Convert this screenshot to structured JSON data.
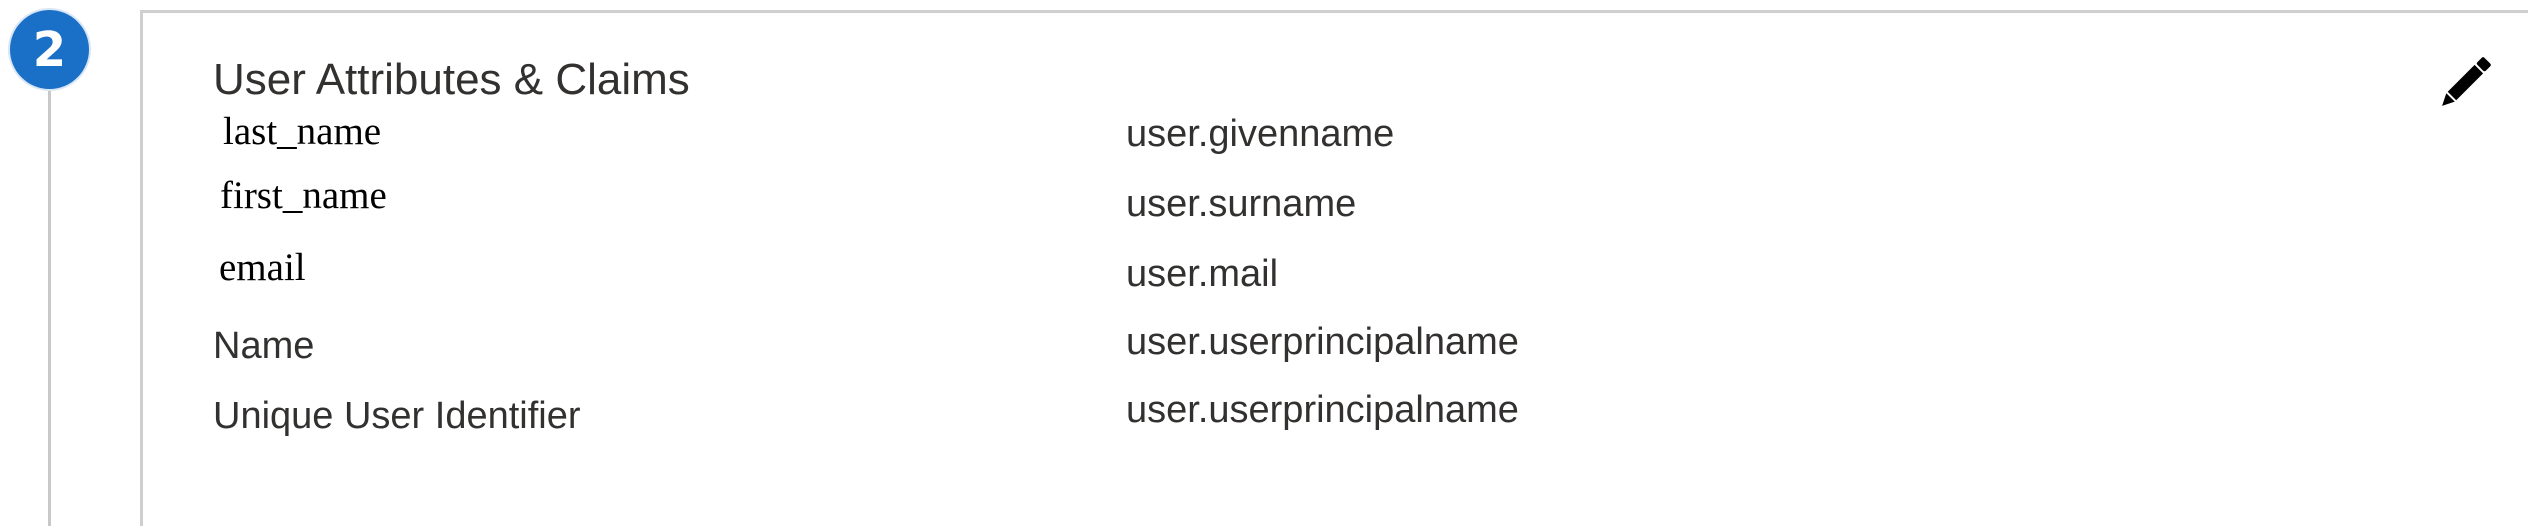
{
  "step": {
    "number": "2"
  },
  "section": {
    "title": "User Attributes & Claims",
    "edit_icon": "pencil-icon"
  },
  "claims": [
    {
      "name": "last_name",
      "value": "user.givenname"
    },
    {
      "name": "first_name",
      "value": "user.surname"
    },
    {
      "name": "email",
      "value": "user.mail"
    },
    {
      "name": "Name",
      "value": "user.userprincipalname"
    },
    {
      "name": "Unique User Identifier",
      "value": "user.userprincipalname"
    }
  ],
  "colors": {
    "step_badge": "#1a6fc7",
    "text": "#323130",
    "border": "#cfcfcf"
  }
}
